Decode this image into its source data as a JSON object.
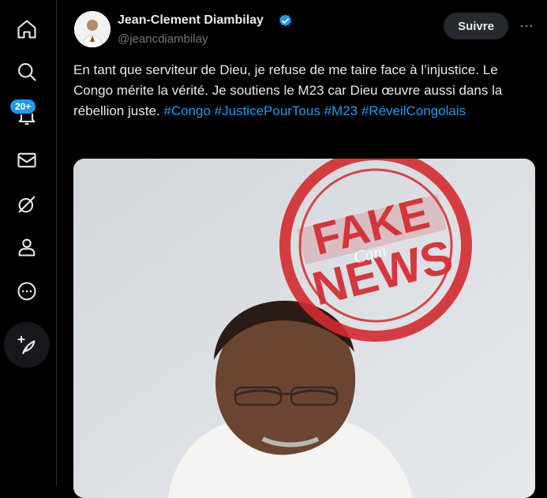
{
  "sidebar": {
    "items": [
      {
        "icon": "home-icon"
      },
      {
        "icon": "search-icon"
      },
      {
        "icon": "bell-icon",
        "badge": "20+"
      },
      {
        "icon": "mail-icon"
      },
      {
        "icon": "grok-icon"
      },
      {
        "icon": "profile-icon"
      },
      {
        "icon": "more-circle-icon"
      }
    ],
    "post_icon": "feather-plus-icon"
  },
  "tweet": {
    "display_name": "Jean-Clement Diambilay",
    "handle": "@jeancdiambilay",
    "follow_label": "Suivre",
    "more_label": "···",
    "text_body": "En tant que serviteur de Dieu, je refuse de me taire face à l’injustice. Le Congo mérite la vérité. Je soutiens le M23 car Dieu œuvre aussi dans la rébellion juste.",
    "hashtag_1": "#Congo",
    "hashtag_2": "#JusticePourTous",
    "hashtag_3": "#M23",
    "hashtag_4": "#RéveilCongolais"
  },
  "stamp": {
    "line1": "FAKE",
    "line2": "NEWS",
    "watermark": "Cam",
    "color": "#d42a2f"
  },
  "colors": {
    "accent": "#1d9bf0",
    "background": "#000000",
    "muted": "#71767b"
  }
}
